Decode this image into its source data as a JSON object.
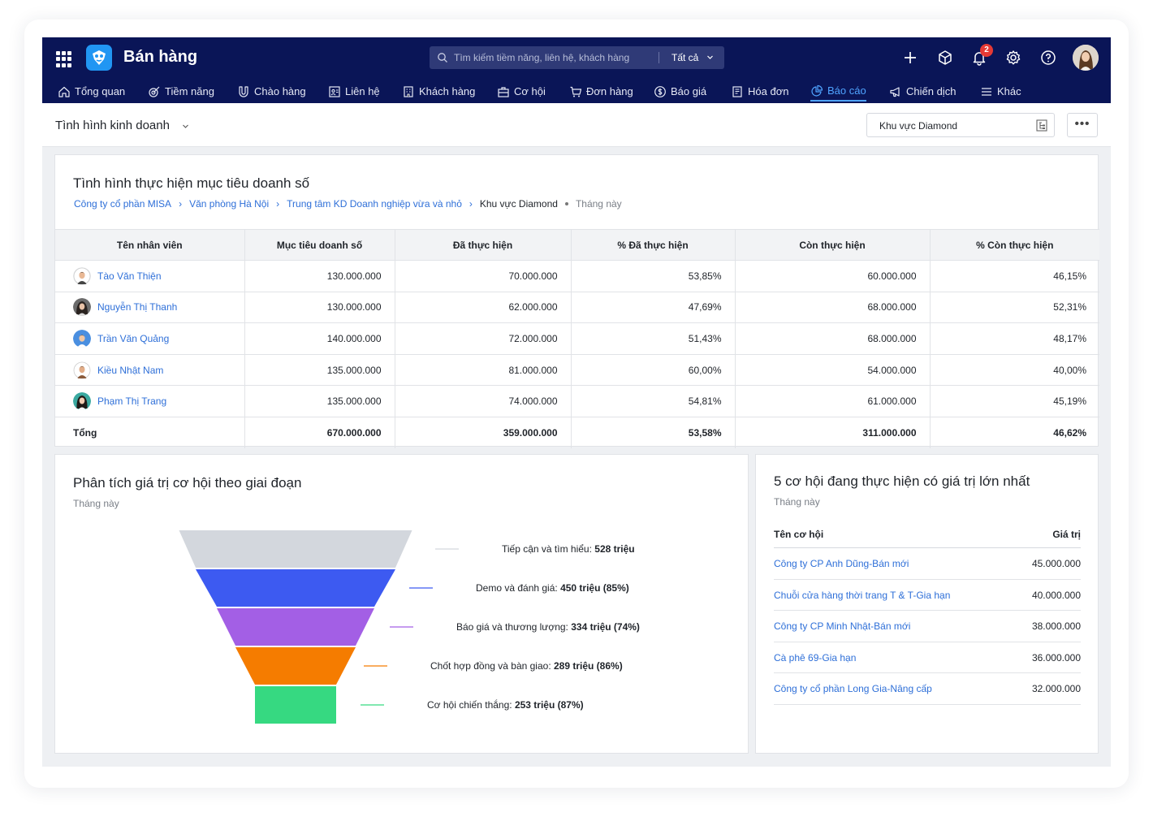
{
  "app": {
    "title": "Bán hàng"
  },
  "search": {
    "placeholder": "Tìm kiếm tiềm năng, liên hệ, khách hàng",
    "scope": "Tất cả"
  },
  "notifications": {
    "count": "2"
  },
  "nav": [
    {
      "label": "Tổng quan",
      "icon": "home-icon"
    },
    {
      "label": "Tiềm năng",
      "icon": "target-icon"
    },
    {
      "label": "Chào hàng",
      "icon": "magnet-icon"
    },
    {
      "label": "Liên hệ",
      "icon": "contact-card-icon"
    },
    {
      "label": "Khách hàng",
      "icon": "building-icon"
    },
    {
      "label": "Cơ hội",
      "icon": "briefcase-icon"
    },
    {
      "label": "Đơn hàng",
      "icon": "cart-icon"
    },
    {
      "label": "Báo giá",
      "icon": "dollar-circle-icon"
    },
    {
      "label": "Hóa đơn",
      "icon": "invoice-icon"
    },
    {
      "label": "Báo cáo",
      "icon": "pie-chart-icon",
      "active": true
    },
    {
      "label": "Chiến dịch",
      "icon": "megaphone-icon"
    },
    {
      "label": "Khác",
      "icon": "menu-icon"
    }
  ],
  "subheader": {
    "title": "Tình hình kinh doanh",
    "region": "Khu vực Diamond"
  },
  "sales_target": {
    "title": "Tình hình thực hiện mục tiêu doanh số",
    "breadcrumb": [
      "Công ty cổ phần MISA",
      "Văn phòng Hà Nội",
      "Trung tâm KD Doanh nghiệp vừa và nhỏ"
    ],
    "current": "Khu vực Diamond",
    "period": "Tháng này",
    "columns": [
      "Tên nhân viên",
      "Mục tiêu doanh số",
      "Đã thực hiện",
      "% Đã thực hiện",
      "Còn thực hiện",
      "% Còn thực hiện"
    ],
    "rows": [
      {
        "name": "Tào Văn Thiện",
        "target": "130.000.000",
        "done": "70.000.000",
        "done_pct": "53,85%",
        "remain": "60.000.000",
        "remain_pct": "46,15%"
      },
      {
        "name": "Nguyễn Thị Thanh",
        "target": "130.000.000",
        "done": "62.000.000",
        "done_pct": "47,69%",
        "remain": "68.000.000",
        "remain_pct": "52,31%"
      },
      {
        "name": "Trần Văn Quảng",
        "target": "140.000.000",
        "done": "72.000.000",
        "done_pct": "51,43%",
        "remain": "68.000.000",
        "remain_pct": "48,17%"
      },
      {
        "name": "Kiều Nhật Nam",
        "target": "135.000.000",
        "done": "81.000.000",
        "done_pct": "60,00%",
        "remain": "54.000.000",
        "remain_pct": "40,00%"
      },
      {
        "name": "Phạm Thị Trang",
        "target": "135.000.000",
        "done": "74.000.000",
        "done_pct": "54,81%",
        "remain": "61.000.000",
        "remain_pct": "45,19%"
      }
    ],
    "total": {
      "label": "Tổng",
      "target": "670.000.000",
      "done": "359.000.000",
      "done_pct": "53,58%",
      "remain": "311.000.000",
      "remain_pct": "46,62%"
    }
  },
  "funnel_card": {
    "title": "Phân tích giá trị cơ hội theo giai đoạn",
    "period": "Tháng này"
  },
  "chart_data": {
    "type": "funnel",
    "title": "Phân tích giá trị cơ hội theo giai đoạn",
    "unit": "triệu",
    "stages": [
      {
        "name": "Tiếp cận và tìm hiểu",
        "value": 528,
        "value_label": "528 triệu",
        "color": "#d3d7dd"
      },
      {
        "name": "Demo và đánh giá",
        "value": 450,
        "value_label": "450 triệu (85%)",
        "color": "#3d5af1"
      },
      {
        "name": "Báo giá và thương lượng",
        "value": 334,
        "value_label": "334 triệu (74%)",
        "color": "#a35fe5"
      },
      {
        "name": "Chốt hợp đồng và bàn giao",
        "value": 289,
        "value_label": "289 triệu (86%)",
        "color": "#f57c00"
      },
      {
        "name": "Cơ hội chiến thắng",
        "value": 253,
        "value_label": "253 triệu (87%)",
        "color": "#36d981"
      }
    ]
  },
  "top_opps": {
    "title": "5 cơ hội đang thực hiện có giá trị lớn nhất",
    "period": "Tháng này",
    "col_name": "Tên cơ hội",
    "col_value": "Giá trị",
    "rows": [
      {
        "name": "Công ty CP Anh Dũng-Bán mới",
        "value": "45.000.000"
      },
      {
        "name": "Chuỗi cửa hàng thời trang T & T-Gia hạn",
        "value": "40.000.000"
      },
      {
        "name": "Công ty CP Minh Nhật-Bán mới",
        "value": "38.000.000"
      },
      {
        "name": "Cà phê 69-Gia hạn",
        "value": "36.000.000"
      },
      {
        "name": "Công ty cổ phần Long Gia-Nâng cấp",
        "value": "32.000.000"
      }
    ]
  },
  "colors": {
    "topbar": "#0a1557",
    "accent": "#2e6fd8",
    "nav_active": "#4fa3ff"
  }
}
